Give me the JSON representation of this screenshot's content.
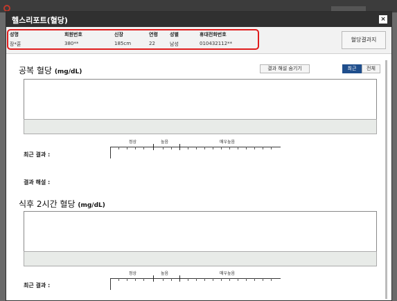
{
  "dialog": {
    "title": "헬스리포트(혈당)",
    "close_icon": "×",
    "result_button": "혈당결과지"
  },
  "user_info": {
    "columns": [
      {
        "header": "성명",
        "value": "장*훈"
      },
      {
        "header": "회원번호",
        "value": "380**"
      },
      {
        "header": "신장",
        "value": "185cm"
      },
      {
        "header": "연령",
        "value": "22"
      },
      {
        "header": "성별",
        "value": "남성"
      },
      {
        "header": "휴대전화번호",
        "value": "010432112**"
      }
    ]
  },
  "controls": {
    "hide_interpretation": "결과 해설 숨기기",
    "tab_recent": "최근",
    "tab_all": "전체"
  },
  "sections": [
    {
      "title": "공복 혈당",
      "unit": "(mg/dL)",
      "recent_label": "최근 결과 :",
      "interpretation_label": "결과 해설 :",
      "scale_labels": [
        "정상",
        "높음",
        "매우높음"
      ]
    },
    {
      "title": "식후 2시간 혈당",
      "unit": "(mg/dL)",
      "recent_label": "최근 결과 :",
      "scale_labels": [
        "정상",
        "높음",
        "매우높음"
      ]
    }
  ]
}
